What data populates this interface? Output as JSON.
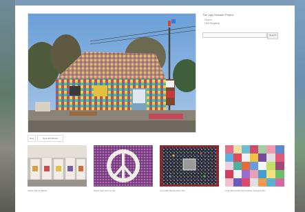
{
  "sidebar": {
    "title": "The Ugly Sweater Project",
    "links": [
      "Home",
      "Gift Registry"
    ]
  },
  "search": {
    "placeholder": "",
    "button_label": "Search"
  },
  "pager": {
    "prev_label": "New",
    "next_label": "Next Gift Photos"
  },
  "gallery": [
    {
      "caption": "Yellow Tote Ts Bands"
    },
    {
      "caption": "Peace Sign Granny Set"
    },
    {
      "caption": "Love Mac Mosaic Floor Tile"
    },
    {
      "caption": "Color Block Plain Pet Cushion Inaugura Set"
    }
  ]
}
